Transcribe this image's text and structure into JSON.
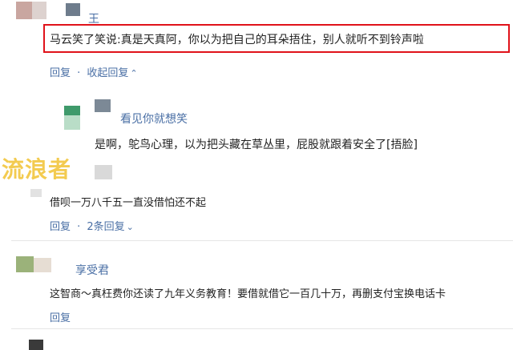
{
  "comment1": {
    "name": "王",
    "text": "马云笑了笑说:真是天真阿，你以为把自己的耳朵捂住，别人就听不到铃声啦",
    "actions": {
      "reply": "回复",
      "separator": "·",
      "collapse": "收起回复"
    }
  },
  "reply1": {
    "name": "看见你就想笑",
    "text": "是啊，鸵鸟心理，以为把头藏在草丛里，屁股就跟着安全了[捂脸]"
  },
  "comment2": {
    "text": "借呗一万八千五一直没借怕还不起",
    "actions": {
      "reply": "回复",
      "separator": "·",
      "count_replies": "2条回复"
    }
  },
  "comment3": {
    "name": "享受君",
    "text": "这智商～真枉费你还读了九年义务教育！要借就借它一百几十万，再删支付宝换电话卡",
    "actions": {
      "reply": "回复"
    }
  },
  "watermark": "流浪者",
  "colors": {
    "link": "#4a6fa5",
    "highlight": "#e0121a",
    "watermark": "#f1c232"
  }
}
